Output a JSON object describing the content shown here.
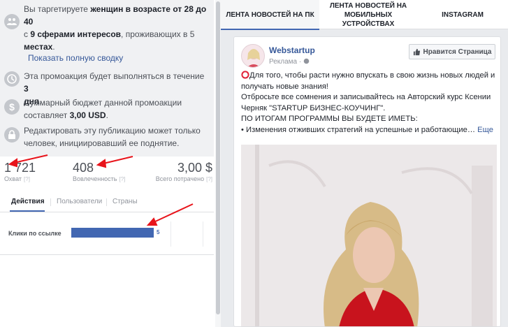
{
  "summary": {
    "targeting": {
      "icon": "people-icon",
      "prefix": "Вы таргетируете",
      "bold": "женщин в возрасте от 28 до 40",
      "line2_mid": " с ",
      "line2_bold": "9 сферами интересов",
      "line2_tail": ", проживающих в 5",
      "line3_bold": "местах",
      "line3_tail": "."
    },
    "full_summary_link": "Показать полную сводку",
    "duration": {
      "icon": "clock-icon",
      "text": "Эта промоакция будет выполняться в течение",
      "bold_num": "3",
      "bold_unit": "дня",
      "tail": "."
    },
    "budget": {
      "icon": "dollar-icon",
      "text": "Суммарный бюджет данной промоакции",
      "text2": "составляет",
      "bold": "3,00 USD",
      "tail": "."
    },
    "edit": {
      "icon": "lock-icon",
      "line1": "Редактировать эту публикацию может только",
      "line2": "человек, инициировавший ее поднятие."
    }
  },
  "metrics": [
    {
      "value": "1 721",
      "label": "Охват",
      "help": "[?]"
    },
    {
      "value": "408",
      "label": "Вовлеченность",
      "help": "[?]"
    },
    {
      "value": "3,00 $",
      "label": "Всего потрачено",
      "help": "[?]"
    }
  ],
  "tabs": [
    "Действия",
    "Пользователи",
    "Страны"
  ],
  "clicks": {
    "label": "Клики по ссылке",
    "value": "5",
    "bar_fraction": 1.0
  },
  "preview_tabs": [
    "ЛЕНТА НОВОСТЕЙ НА ПК",
    "ЛЕНТА НОВОСТЕЙ НА МОБИЛЬНЫХ УСТРОЙСТВАХ",
    "INSTAGRAM"
  ],
  "post": {
    "page_name": "Webstartup",
    "sponsored": "Реклама ·",
    "like_button": "Нравится Страница",
    "lines": [
      "Для того, чтобы расти нужно впускать в свою жизнь новых людей и",
      "получать новые знания!",
      "Отбросьте все сомнения и записывайтесь на Авторский курс Ксении",
      "Черняк \"STARTUP БИЗНЕС-КОУЧИНГ\".",
      "ПО ИТОГАМ ПРОГРАММЫ ВЫ БУДЕТЕ ИМЕТЬ:",
      "• Изменения отживших стратегий на успешные и работающие…"
    ],
    "more": "Еще"
  },
  "colors": {
    "accent": "#4267b2",
    "link": "#365899",
    "arrow": "#e8141b",
    "summary_bg": "#f0f1f3"
  }
}
